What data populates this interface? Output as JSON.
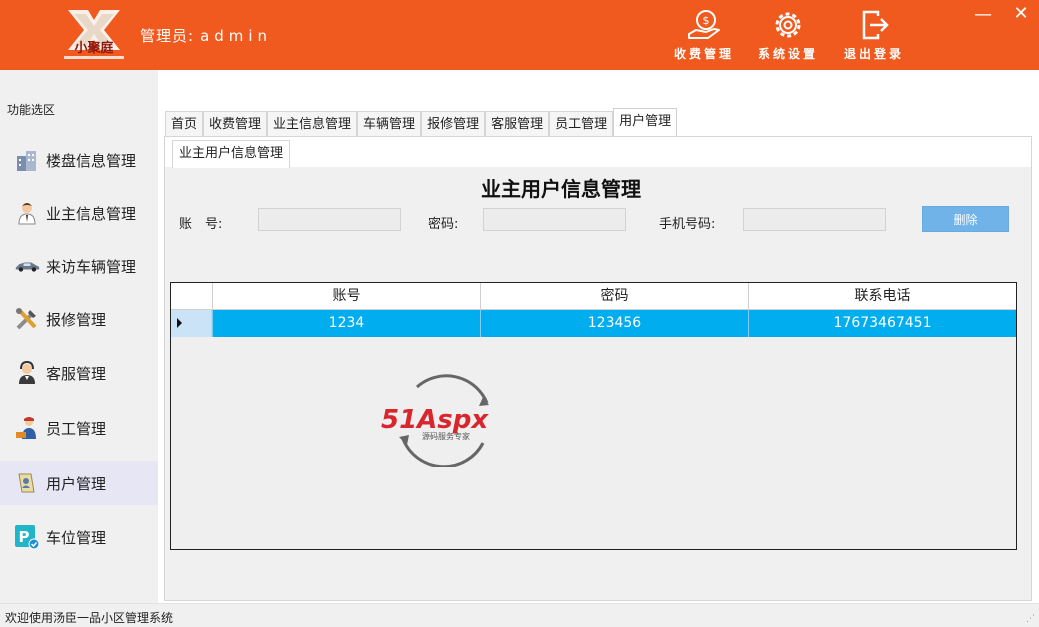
{
  "header": {
    "logo_text": "小聚庭",
    "admin_label": "管理员:",
    "admin_name": "admin",
    "buttons": [
      {
        "label": "收费管理",
        "icon": "money-hand-icon"
      },
      {
        "label": "系统设置",
        "icon": "gear-icon"
      },
      {
        "label": "退出登录",
        "icon": "logout-icon"
      }
    ],
    "minimize_glyph": "—",
    "close_glyph": "✕"
  },
  "sidebar": {
    "title": "功能选区",
    "items": [
      {
        "label": "楼盘信息管理",
        "icon": "buildings-icon"
      },
      {
        "label": "业主信息管理",
        "icon": "person-icon"
      },
      {
        "label": "来访车辆管理",
        "icon": "car-icon"
      },
      {
        "label": "报修管理",
        "icon": "tools-icon"
      },
      {
        "label": "客服管理",
        "icon": "headset-agent-icon"
      },
      {
        "label": "员工管理",
        "icon": "worker-icon"
      },
      {
        "label": "用户管理",
        "icon": "user-card-icon"
      },
      {
        "label": "车位管理",
        "icon": "parking-icon"
      }
    ],
    "active_index": 6
  },
  "tabs": [
    "首页",
    "收费管理",
    "业主信息管理",
    "车辆管理",
    "报修管理",
    "客服管理",
    "员工管理",
    "用户管理"
  ],
  "active_tab": 7,
  "subtab": "业主用户信息管理",
  "page_title": "业主用户信息管理",
  "form": {
    "account_label": "账　号:",
    "password_label": "密码:",
    "phone_label": "手机号码:",
    "account_value": "",
    "password_value": "",
    "phone_value": "",
    "delete_label": "删除"
  },
  "grid": {
    "columns": [
      "账号",
      "密码",
      "联系电话"
    ],
    "rows": [
      {
        "account": "1234",
        "password": "123456",
        "phone": "17673467451"
      }
    ]
  },
  "watermark": {
    "brand": "51Aspx",
    "slogan": "源码服务专家"
  },
  "status": "欢迎使用汤臣一品小区管理系统",
  "colors": {
    "header": "#f05a1e",
    "row_selected": "#00aeef",
    "delete_button": "#6fb3e8",
    "sidebar_active": "#e6e6f5"
  }
}
